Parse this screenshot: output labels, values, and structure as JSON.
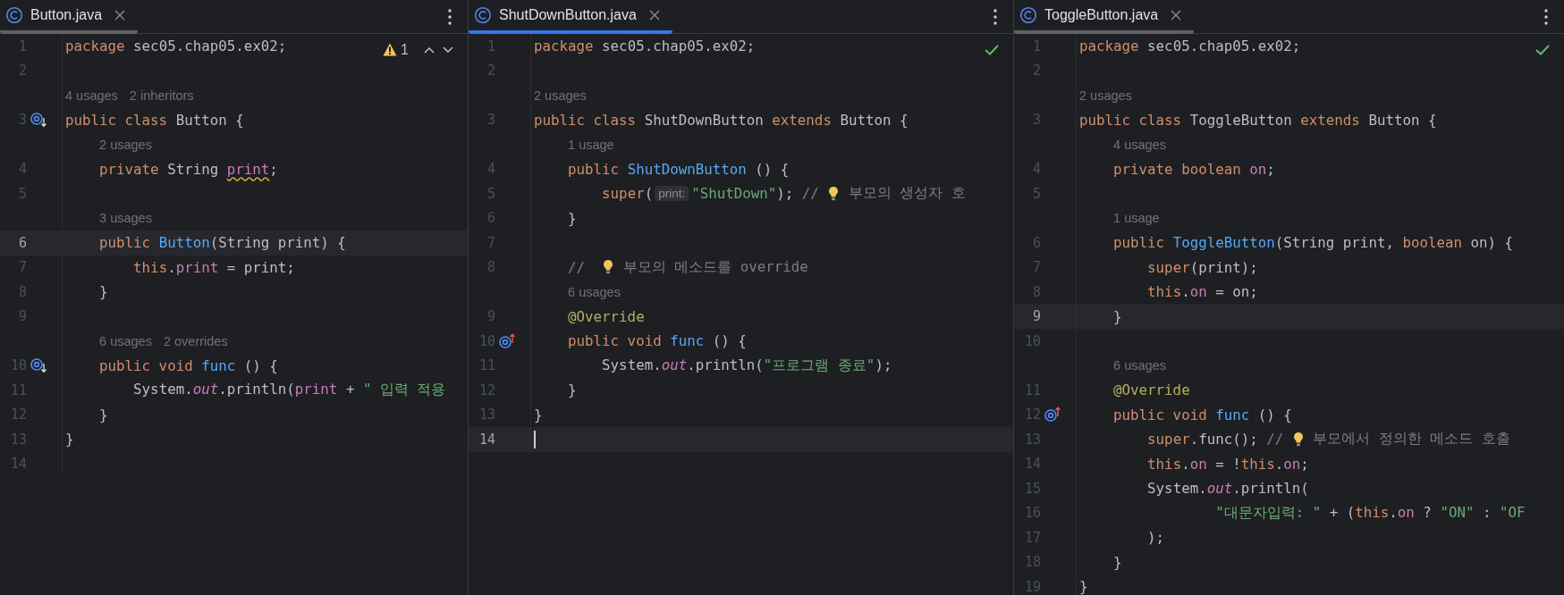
{
  "panes": [
    {
      "tab": {
        "label": "Button.java",
        "selected": false
      },
      "inspection": {
        "kind": "warning",
        "count": "1"
      },
      "lines": [
        {
          "number": "1",
          "current": false,
          "tokens": [
            {
              "kind": "keyword",
              "text": "package "
            },
            {
              "kind": "plain",
              "text": "sec05.chap05.ex02;"
            }
          ]
        },
        {
          "number": "2",
          "current": false
        },
        {
          "number": "3",
          "current": false,
          "hints": [
            "4 usages",
            "2 inheritors"
          ],
          "gutter": {
            "kind": "overridden"
          },
          "tokens": [
            {
              "kind": "keyword",
              "text": "public class "
            },
            {
              "kind": "plain",
              "text": "Button {"
            }
          ]
        },
        {
          "number": "4",
          "current": false,
          "hints": [
            "2 usages"
          ],
          "tokens": [
            {
              "kind": "keyword",
              "text": "    private"
            },
            {
              "kind": "plain",
              "text": " String "
            },
            {
              "kind": "field-warning",
              "text": "print"
            },
            {
              "kind": "plain",
              "text": ";"
            }
          ]
        },
        {
          "number": "5",
          "current": false
        },
        {
          "number": "6",
          "current": true,
          "hints": [
            "3 usages"
          ],
          "tokens": [
            {
              "kind": "keyword",
              "text": "    public "
            },
            {
              "kind": "declaration",
              "text": "Button"
            },
            {
              "kind": "plain",
              "text": "(String print) {"
            }
          ]
        },
        {
          "number": "7",
          "current": false,
          "tokens": [
            {
              "kind": "keyword",
              "text": "        this"
            },
            {
              "kind": "plain",
              "text": "."
            },
            {
              "kind": "field",
              "text": "print"
            },
            {
              "kind": "plain",
              "text": " = print;"
            }
          ]
        },
        {
          "number": "8",
          "current": false,
          "tokens": [
            {
              "kind": "plain",
              "text": "    }"
            }
          ]
        },
        {
          "number": "9",
          "current": false
        },
        {
          "number": "10",
          "current": false,
          "hints": [
            "6 usages",
            "2 overrides"
          ],
          "gutter": {
            "kind": "overridden"
          },
          "tokens": [
            {
              "kind": "keyword",
              "text": "    public void "
            },
            {
              "kind": "declaration",
              "text": "func"
            },
            {
              "kind": "plain",
              "text": " () {"
            }
          ]
        },
        {
          "number": "11",
          "current": false,
          "tokens": [
            {
              "kind": "plain",
              "text": "        System."
            },
            {
              "kind": "static",
              "text": "out"
            },
            {
              "kind": "plain",
              "text": ".println("
            },
            {
              "kind": "field",
              "text": "print"
            },
            {
              "kind": "plain",
              "text": " + "
            },
            {
              "kind": "string",
              "text": "\" 입력 적용"
            }
          ]
        },
        {
          "number": "12",
          "current": false,
          "tokens": [
            {
              "kind": "plain",
              "text": "    }"
            }
          ]
        },
        {
          "number": "13",
          "current": false,
          "tokens": [
            {
              "kind": "plain",
              "text": "}"
            }
          ]
        },
        {
          "number": "14",
          "current": false
        }
      ]
    },
    {
      "tab": {
        "label": "ShutDownButton.java",
        "selected": true
      },
      "inspection": {
        "kind": "ok"
      },
      "lines": [
        {
          "number": "1",
          "current": false,
          "tokens": [
            {
              "kind": "keyword",
              "text": "package "
            },
            {
              "kind": "plain",
              "text": "sec05.chap05.ex02;"
            }
          ]
        },
        {
          "number": "2",
          "current": false
        },
        {
          "number": "3",
          "current": false,
          "hints": [
            "2 usages"
          ],
          "tokens": [
            {
              "kind": "keyword",
              "text": "public class "
            },
            {
              "kind": "plain",
              "text": "ShutDownButton "
            },
            {
              "kind": "keyword",
              "text": "extends "
            },
            {
              "kind": "plain",
              "text": "Button {"
            }
          ]
        },
        {
          "number": "4",
          "current": false,
          "hints": [
            "1 usage"
          ],
          "tokens": [
            {
              "kind": "keyword",
              "text": "    public "
            },
            {
              "kind": "declaration",
              "text": "ShutDownButton"
            },
            {
              "kind": "plain",
              "text": " () {"
            }
          ]
        },
        {
          "number": "5",
          "current": false,
          "tokens": [
            {
              "kind": "keyword",
              "text": "        super"
            },
            {
              "kind": "plain",
              "text": "("
            },
            {
              "kind": "param-hint",
              "text": "print:"
            },
            {
              "kind": "string",
              "text": "\"ShutDown\""
            },
            {
              "kind": "plain",
              "text": "); "
            },
            {
              "kind": "comment",
              "text": "// "
            },
            {
              "kind": "bulb"
            },
            {
              "kind": "comment",
              "text": " 부모의 생성자 호"
            }
          ]
        },
        {
          "number": "6",
          "current": false,
          "tokens": [
            {
              "kind": "plain",
              "text": "    }"
            }
          ]
        },
        {
          "number": "7",
          "current": false
        },
        {
          "number": "8",
          "current": false,
          "tokens": [
            {
              "kind": "comment",
              "text": "    //  "
            },
            {
              "kind": "bulb"
            },
            {
              "kind": "comment",
              "text": " 부모의 메소드를 override"
            }
          ]
        },
        {
          "number": "9",
          "current": false,
          "hints": [
            "6 usages"
          ],
          "tokens": [
            {
              "kind": "annotation",
              "text": "    @Override"
            }
          ]
        },
        {
          "number": "10",
          "current": false,
          "gutter": {
            "kind": "overriding"
          },
          "tokens": [
            {
              "kind": "keyword",
              "text": "    public void "
            },
            {
              "kind": "declaration",
              "text": "func"
            },
            {
              "kind": "plain",
              "text": " () {"
            }
          ]
        },
        {
          "number": "11",
          "current": false,
          "tokens": [
            {
              "kind": "plain",
              "text": "        System."
            },
            {
              "kind": "static",
              "text": "out"
            },
            {
              "kind": "plain",
              "text": ".println("
            },
            {
              "kind": "string",
              "text": "\"프로그램 종료\""
            },
            {
              "kind": "plain",
              "text": ");"
            }
          ]
        },
        {
          "number": "12",
          "current": false,
          "tokens": [
            {
              "kind": "plain",
              "text": "    }"
            }
          ]
        },
        {
          "number": "13",
          "current": false,
          "tokens": [
            {
              "kind": "plain",
              "text": "}"
            }
          ]
        },
        {
          "number": "14",
          "current": true
        }
      ]
    },
    {
      "tab": {
        "label": "ToggleButton.java",
        "selected": false
      },
      "inspection": {
        "kind": "ok"
      },
      "lines": [
        {
          "number": "1",
          "current": false,
          "tokens": [
            {
              "kind": "keyword",
              "text": "package "
            },
            {
              "kind": "plain",
              "text": "sec05.chap05.ex02;"
            }
          ]
        },
        {
          "number": "2",
          "current": false
        },
        {
          "number": "3",
          "current": false,
          "hints": [
            "2 usages"
          ],
          "tokens": [
            {
              "kind": "keyword",
              "text": "public class "
            },
            {
              "kind": "plain",
              "text": "ToggleButton "
            },
            {
              "kind": "keyword",
              "text": "extends "
            },
            {
              "kind": "plain",
              "text": "Button {"
            }
          ]
        },
        {
          "number": "4",
          "current": false,
          "hints": [
            "4 usages"
          ],
          "tokens": [
            {
              "kind": "keyword",
              "text": "    private boolean "
            },
            {
              "kind": "field",
              "text": "on"
            },
            {
              "kind": "plain",
              "text": ";"
            }
          ]
        },
        {
          "number": "5",
          "current": false
        },
        {
          "number": "6",
          "current": false,
          "hints": [
            "1 usage"
          ],
          "tokens": [
            {
              "kind": "keyword",
              "text": "    public "
            },
            {
              "kind": "declaration",
              "text": "ToggleButton"
            },
            {
              "kind": "plain",
              "text": "(String print, "
            },
            {
              "kind": "keyword",
              "text": "boolean "
            },
            {
              "kind": "plain",
              "text": "on) {"
            }
          ]
        },
        {
          "number": "7",
          "current": false,
          "tokens": [
            {
              "kind": "keyword",
              "text": "        super"
            },
            {
              "kind": "plain",
              "text": "(print);"
            }
          ]
        },
        {
          "number": "8",
          "current": false,
          "tokens": [
            {
              "kind": "keyword",
              "text": "        this"
            },
            {
              "kind": "plain",
              "text": "."
            },
            {
              "kind": "field",
              "text": "on"
            },
            {
              "kind": "plain",
              "text": " = on;"
            }
          ]
        },
        {
          "number": "9",
          "current": true,
          "tokens": [
            {
              "kind": "plain",
              "text": "    }"
            }
          ]
        },
        {
          "number": "10",
          "current": false
        },
        {
          "number": "11",
          "current": false,
          "hints": [
            "6 usages"
          ],
          "tokens": [
            {
              "kind": "annotation",
              "text": "    @Override"
            }
          ]
        },
        {
          "number": "12",
          "current": false,
          "gutter": {
            "kind": "overriding"
          },
          "tokens": [
            {
              "kind": "keyword",
              "text": "    public void "
            },
            {
              "kind": "declaration",
              "text": "func"
            },
            {
              "kind": "plain",
              "text": " () {"
            }
          ]
        },
        {
          "number": "13",
          "current": false,
          "tokens": [
            {
              "kind": "keyword",
              "text": "        super"
            },
            {
              "kind": "plain",
              "text": ".func(); "
            },
            {
              "kind": "comment",
              "text": "// "
            },
            {
              "kind": "bulb"
            },
            {
              "kind": "comment",
              "text": " 부모에서 정의한 메소드 호출"
            }
          ]
        },
        {
          "number": "14",
          "current": false,
          "tokens": [
            {
              "kind": "keyword",
              "text": "        this"
            },
            {
              "kind": "plain",
              "text": "."
            },
            {
              "kind": "field",
              "text": "on"
            },
            {
              "kind": "plain",
              "text": " = !"
            },
            {
              "kind": "keyword",
              "text": "this"
            },
            {
              "kind": "plain",
              "text": "."
            },
            {
              "kind": "field",
              "text": "on"
            },
            {
              "kind": "plain",
              "text": ";"
            }
          ]
        },
        {
          "number": "15",
          "current": false,
          "tokens": [
            {
              "kind": "plain",
              "text": "        System."
            },
            {
              "kind": "static",
              "text": "out"
            },
            {
              "kind": "plain",
              "text": ".println("
            }
          ]
        },
        {
          "number": "16",
          "current": false,
          "tokens": [
            {
              "kind": "string",
              "text": "                \"대문자입력: \""
            },
            {
              "kind": "plain",
              "text": " + ("
            },
            {
              "kind": "keyword",
              "text": "this"
            },
            {
              "kind": "plain",
              "text": "."
            },
            {
              "kind": "field",
              "text": "on"
            },
            {
              "kind": "plain",
              "text": " ? "
            },
            {
              "kind": "string",
              "text": "\"ON\""
            },
            {
              "kind": "plain",
              "text": " : "
            },
            {
              "kind": "string",
              "text": "\"OF"
            }
          ]
        },
        {
          "number": "17",
          "current": false,
          "tokens": [
            {
              "kind": "plain",
              "text": "        );"
            }
          ]
        },
        {
          "number": "18",
          "current": false,
          "tokens": [
            {
              "kind": "plain",
              "text": "    }"
            }
          ]
        },
        {
          "number": "19",
          "current": false,
          "tokens": [
            {
              "kind": "plain",
              "text": "}"
            }
          ]
        }
      ]
    }
  ]
}
